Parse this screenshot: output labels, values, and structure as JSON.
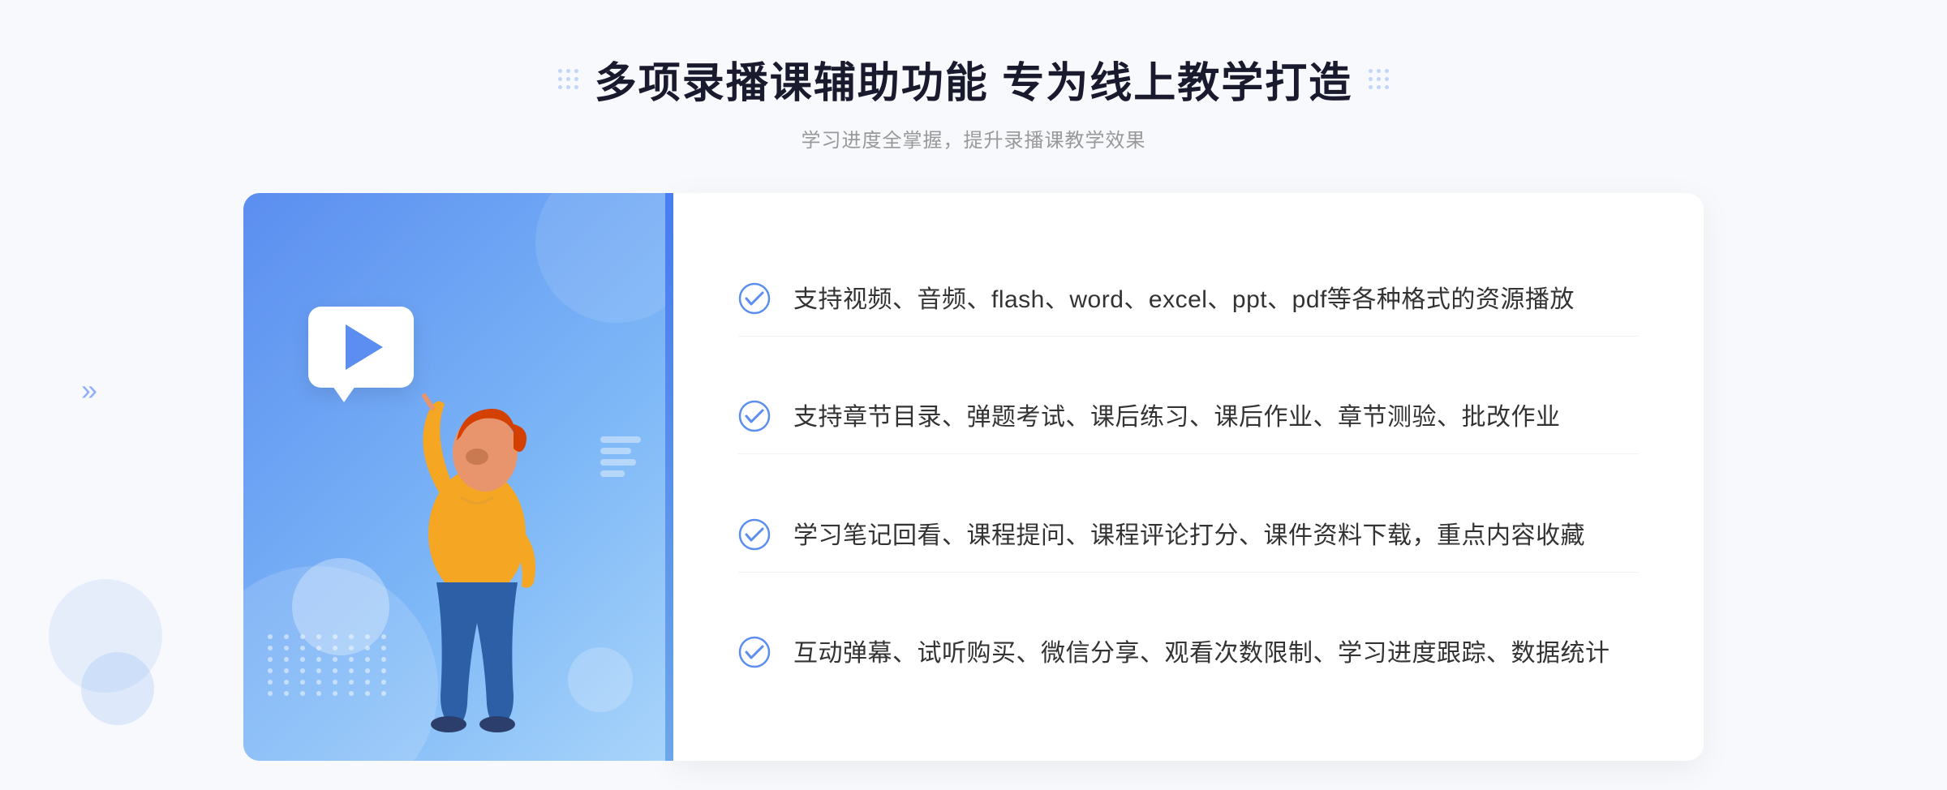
{
  "page": {
    "background": "#f5f7fb"
  },
  "header": {
    "title": "多项录播课辅助功能 专为线上教学打造",
    "subtitle": "学习进度全掌握，提升录播课教学效果",
    "deco_left": "grid-dots",
    "deco_right": "grid-dots"
  },
  "features": [
    {
      "id": 1,
      "text": "支持视频、音频、flash、word、excel、ppt、pdf等各种格式的资源播放"
    },
    {
      "id": 2,
      "text": "支持章节目录、弹题考试、课后练习、课后作业、章节测验、批改作业"
    },
    {
      "id": 3,
      "text": "学习笔记回看、课程提问、课程评论打分、课件资料下载，重点内容收藏"
    },
    {
      "id": 4,
      "text": "互动弹幕、试听购买、微信分享、观看次数限制、学习进度跟踪、数据统计"
    }
  ],
  "illustration": {
    "play_button": "▶",
    "accent_color": "#5b8ef0"
  },
  "icons": {
    "check": "check-circle",
    "chevron": "»"
  }
}
